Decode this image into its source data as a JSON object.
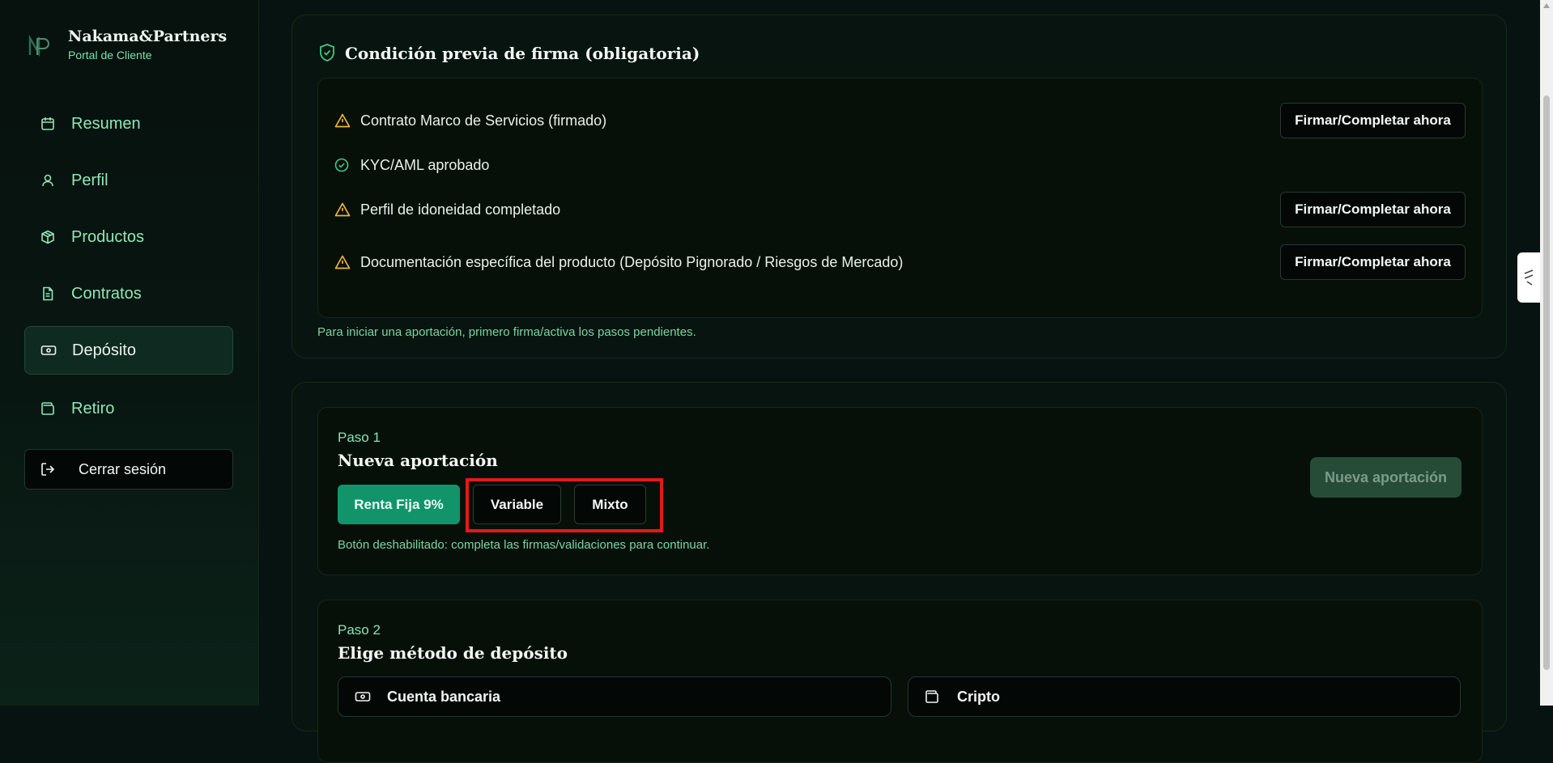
{
  "brand": {
    "name": "Nakama&Partners",
    "subtitle": "Portal de Cliente"
  },
  "sidebar": {
    "items": [
      {
        "label": "Resumen",
        "icon": "calendar-icon"
      },
      {
        "label": "Perfil",
        "icon": "user-icon"
      },
      {
        "label": "Productos",
        "icon": "box-icon"
      },
      {
        "label": "Contratos",
        "icon": "document-icon"
      },
      {
        "label": "Depósito",
        "icon": "banknote-icon",
        "active": true
      },
      {
        "label": "Retiro",
        "icon": "wallet-icon"
      }
    ],
    "logout_label": "Cerrar sesión"
  },
  "precondition": {
    "title": "Condición previa de firma (obligatoria)",
    "items": [
      {
        "label": "Contrato Marco de Servicios (firmado)",
        "status": "warning",
        "action": "Firmar/Completar ahora"
      },
      {
        "label": "KYC/AML aprobado",
        "status": "ok"
      },
      {
        "label": "Perfil de idoneidad completado",
        "status": "warning",
        "action": "Firmar/Completar ahora"
      },
      {
        "label": "Documentación específica del producto (Depósito Pignorado / Riesgos de Mercado)",
        "status": "warning",
        "action": "Firmar/Completar ahora"
      }
    ],
    "hint": "Para iniciar una aportación, primero firma/activa los pasos pendientes."
  },
  "step1": {
    "step_label": "Paso 1",
    "title": "Nueva aportación",
    "options": [
      "Renta Fija 9%",
      "Variable",
      "Mixto"
    ],
    "selected_option": "Renta Fija 9%",
    "action_label": "Nueva aportación",
    "hint": "Botón deshabilitado: completa las firmas/validaciones para continuar."
  },
  "step2": {
    "step_label": "Paso 2",
    "title": "Elige método de depósito",
    "methods": [
      "Cuenta bancaria",
      "Cripto"
    ]
  },
  "colors": {
    "accent": "#11946a",
    "accent_text": "#7ee0ae",
    "warning": "#f2b33d",
    "ok": "#3fc98a",
    "highlight": "#e3191a"
  }
}
